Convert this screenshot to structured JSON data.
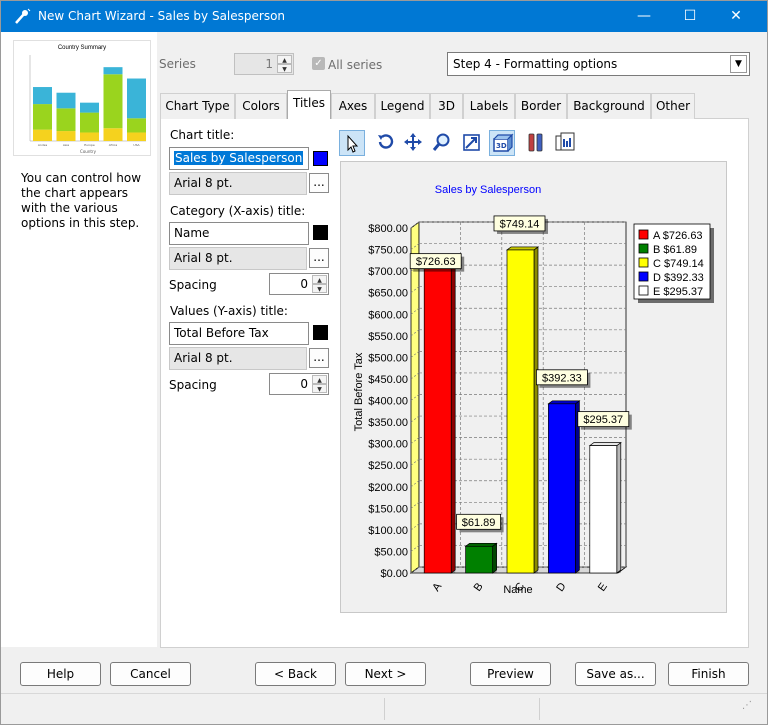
{
  "window": {
    "title": "New Chart Wizard - Sales by Salesperson",
    "controls": {
      "minimize": "—",
      "maximize": "☐",
      "close": "✕"
    }
  },
  "thumbnail": {
    "title": "Country Summary",
    "categories": [
      "Andes",
      "Asia",
      "Europe",
      "Africa",
      "USA"
    ],
    "xlabel": "Country",
    "stacks": [
      [
        {
          "v": 8,
          "c": "#f5d21e"
        },
        {
          "v": 18,
          "c": "#9ad41e"
        },
        {
          "v": 12,
          "c": "#3ab4d8"
        }
      ],
      [
        {
          "v": 7,
          "c": "#f5d21e"
        },
        {
          "v": 16,
          "c": "#9ad41e"
        },
        {
          "v": 11,
          "c": "#3ab4d8"
        }
      ],
      [
        {
          "v": 6,
          "c": "#f5d21e"
        },
        {
          "v": 14,
          "c": "#9ad41e"
        },
        {
          "v": 7,
          "c": "#3ab4d8"
        }
      ],
      [
        {
          "v": 9,
          "c": "#f5d21e"
        },
        {
          "v": 38,
          "c": "#9ad41e"
        },
        {
          "v": 5,
          "c": "#3ab4d8"
        }
      ],
      [
        {
          "v": 6,
          "c": "#f5d21e"
        },
        {
          "v": 10,
          "c": "#9ad41e"
        },
        {
          "v": 28,
          "c": "#3ab4d8"
        }
      ]
    ]
  },
  "help_text": "You can control how the chart appears with the various options in this step.",
  "series": {
    "label": "Series",
    "value": "1",
    "all_series": "All series"
  },
  "step": {
    "selected": "Step 4 - Formatting options"
  },
  "tabs": [
    "Chart Type",
    "Colors",
    "Titles",
    "Axes",
    "Legend",
    "3D",
    "Labels",
    "Border",
    "Background",
    "Other"
  ],
  "selected_tab": "Titles",
  "titles": {
    "chart_title_label": "Chart title:",
    "chart_title_value": "Sales by Salesperson",
    "chart_title_color": "#0000ff",
    "chart_title_font": "Arial 8 pt.",
    "category_label": "Category (X-axis) title:",
    "category_value": "Name",
    "category_color": "#000000",
    "category_font": "Arial 8 pt.",
    "category_spacing_label": "Spacing",
    "category_spacing": "0",
    "values_label": "Values (Y-axis) title:",
    "values_value": "Total Before Tax",
    "values_color": "#000000",
    "values_font": "Arial 8 pt.",
    "values_spacing_label": "Spacing",
    "values_spacing": "0",
    "browse": "..."
  },
  "toolbar": {
    "icons": [
      "pointer-icon",
      "rotate-icon",
      "move-icon",
      "zoom-icon",
      "depth-icon",
      "3d-view-icon",
      "tools-icon",
      "data-grid-icon"
    ]
  },
  "chart_data": {
    "type": "bar",
    "title": "Sales by Salesperson",
    "xlabel": "Name",
    "ylabel": "Total Before Tax",
    "categories": [
      "A",
      "B",
      "C",
      "D",
      "E"
    ],
    "values": [
      726.63,
      61.89,
      749.14,
      392.33,
      295.37
    ],
    "data_labels": [
      "$726.63",
      "$61.89",
      "$749.14",
      "$392.33",
      "$295.37"
    ],
    "colors": [
      "#ff0000",
      "#008000",
      "#ffff00",
      "#0000ff",
      "#ffffff"
    ],
    "ylim": [
      0,
      800
    ],
    "yticks": [
      "$0.00",
      "$50.00",
      "$100.00",
      "$150.00",
      "$200.00",
      "$250.00",
      "$300.00",
      "$350.00",
      "$400.00",
      "$450.00",
      "$500.00",
      "$550.00",
      "$600.00",
      "$650.00",
      "$700.00",
      "$750.00",
      "$800.00"
    ],
    "legend": [
      "A $726.63",
      "B   $61.89",
      "C $749.14",
      "D $392.33",
      "E $295.37"
    ],
    "legend_position": "top-right",
    "grid": true
  },
  "buttons": {
    "help": "Help",
    "cancel": "Cancel",
    "back": "< Back",
    "next": "Next >",
    "preview": "Preview",
    "save_as": "Save as...",
    "finish": "Finish"
  }
}
